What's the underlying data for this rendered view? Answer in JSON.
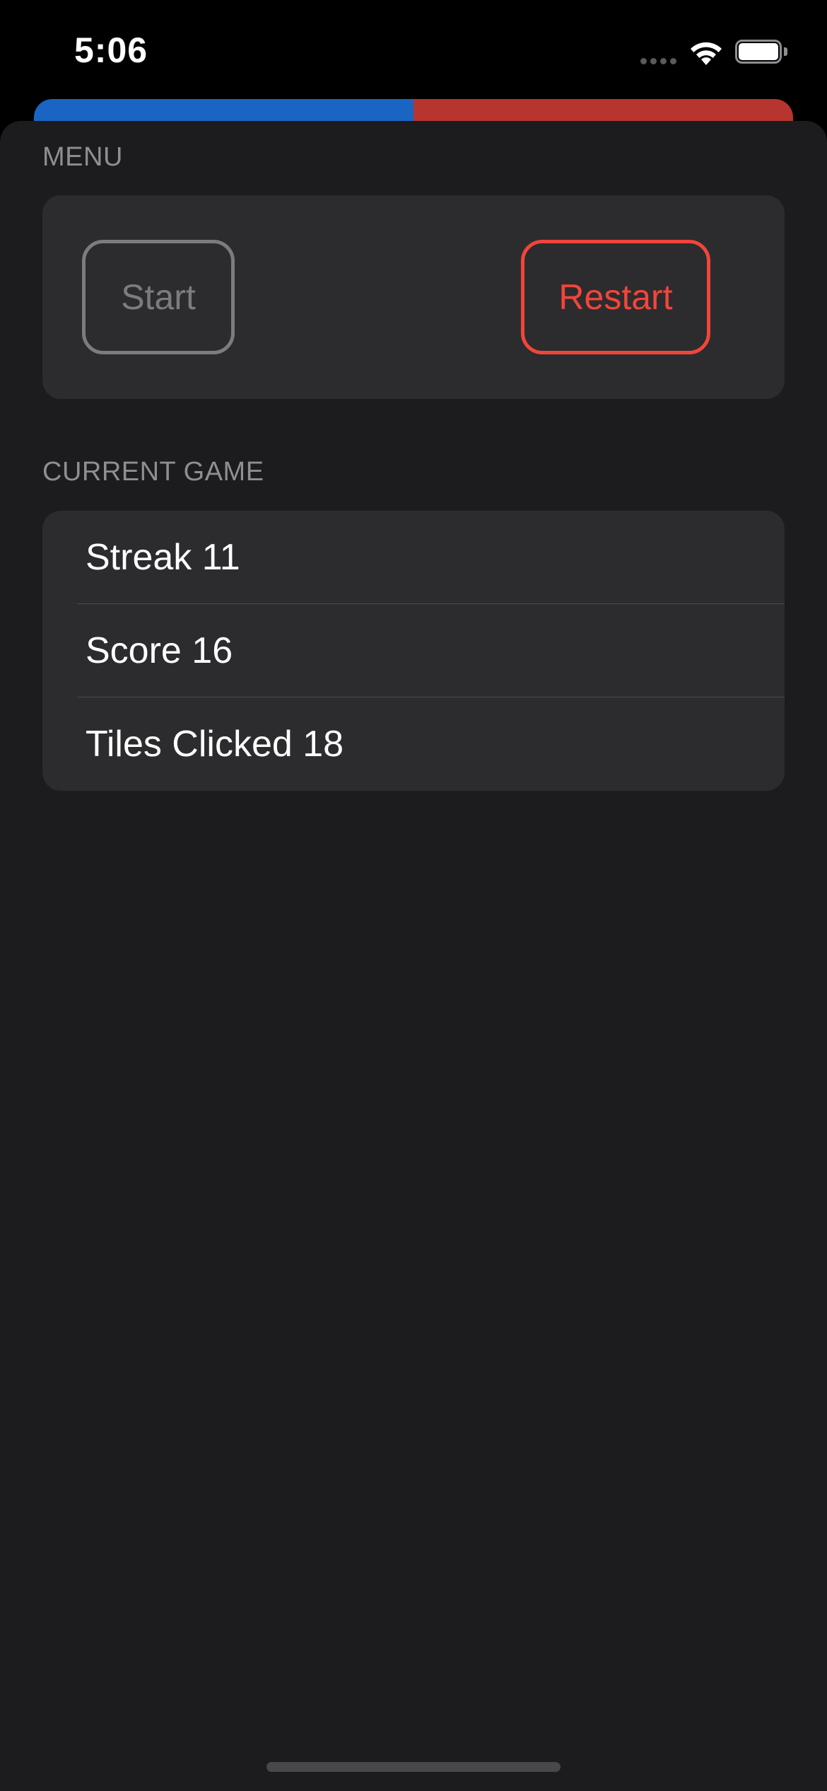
{
  "status_bar": {
    "time": "5:06",
    "icons": [
      "cellular-signal-icon",
      "wifi-icon",
      "battery-icon"
    ]
  },
  "board_colors": {
    "left": "#1a64c4",
    "right": "#b8342e"
  },
  "menu": {
    "header": "MENU",
    "start_label": "Start",
    "restart_label": "Restart"
  },
  "current_game": {
    "header": "CURRENT GAME",
    "rows": [
      {
        "label": "Streak 11"
      },
      {
        "label": "Score 16"
      },
      {
        "label": "Tiles Clicked 18"
      }
    ]
  },
  "colors": {
    "accent_red": "#f2453a",
    "disabled_gray": "#7c7c80",
    "sheet_bg": "#1c1c1e",
    "card_bg": "#2c2c2e"
  }
}
